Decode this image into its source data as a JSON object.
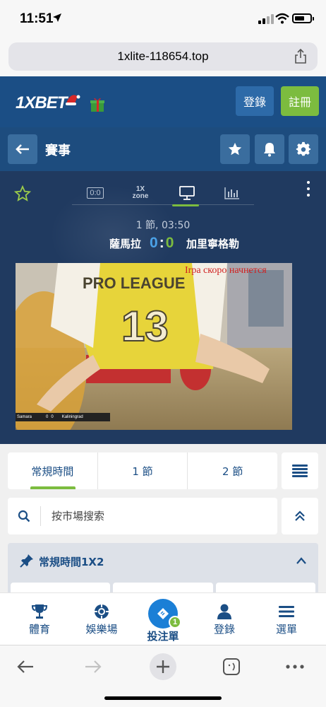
{
  "status_bar": {
    "time": "11:51"
  },
  "browser": {
    "url": "1xlite-118654.top"
  },
  "header": {
    "logo_text": "1XBET",
    "login_label": "登錄",
    "register_label": "註冊"
  },
  "section": {
    "title": "賽事"
  },
  "match": {
    "tab_score_label": "0:0",
    "tab_zone_line1": "1X",
    "tab_zone_line2": "zone",
    "period_time": "1 節, 03:50",
    "home_team": "薩馬拉",
    "home_score": "0",
    "score_sep": ":",
    "away_score": "0",
    "away_team": "加里寧格勒",
    "video": {
      "overlay_text": "Irpa скоро начнется",
      "jersey_text": "PRO LEAGUE",
      "jersey_number": "13",
      "scorebug_home": "Samara",
      "scorebug_home_score": "0",
      "scorebug_away_score": "0",
      "scorebug_away": "Kaliningrad"
    }
  },
  "period_tabs": [
    {
      "label": "常規時間"
    },
    {
      "label": "1 節"
    },
    {
      "label": "2 節"
    }
  ],
  "search": {
    "placeholder": "按市場搜索"
  },
  "market": {
    "title": "常規時間1X2"
  },
  "tabbar": {
    "sports": "體育",
    "casino": "娛樂場",
    "betslip": "投注單",
    "betslip_count": "1",
    "login": "登錄",
    "menu": "選單"
  },
  "colors": {
    "brand_blue": "#1b4e85",
    "accent_green": "#7cbc3f",
    "score_blue": "#4ba2e8",
    "overlay_red": "#d02020"
  }
}
